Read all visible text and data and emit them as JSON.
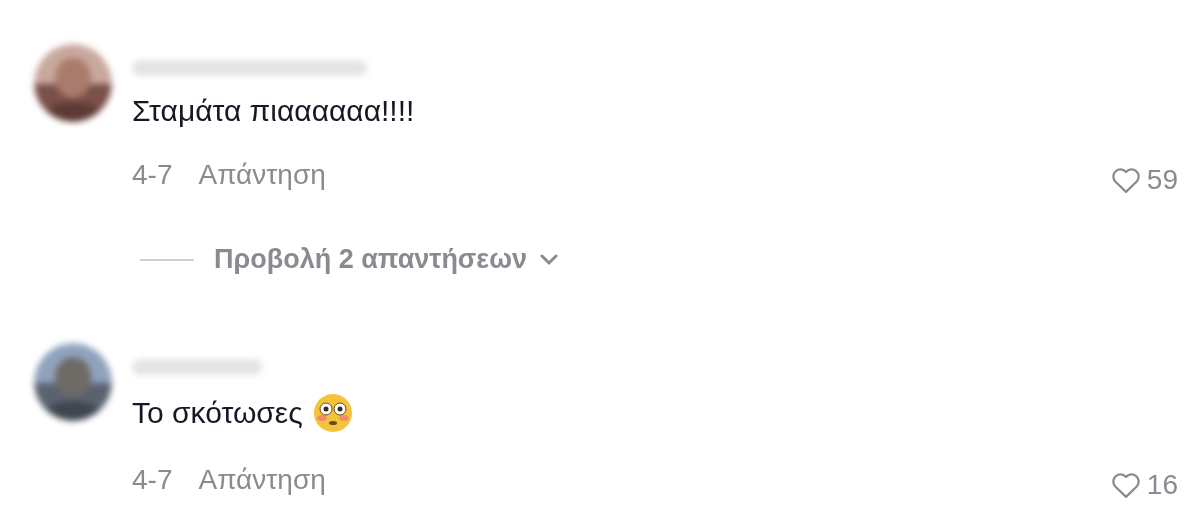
{
  "comments": [
    {
      "text": "Σταμάτα πιαααααα!!!!",
      "date": "4-7",
      "reply_label": "Απάντηση",
      "likes": "59",
      "replies_label": "Προβολή 2 απαντήσεων",
      "emoji": false
    },
    {
      "text": "Το σκότωσες",
      "date": "4-7",
      "reply_label": "Απάντηση",
      "likes": "16",
      "emoji": true
    }
  ]
}
